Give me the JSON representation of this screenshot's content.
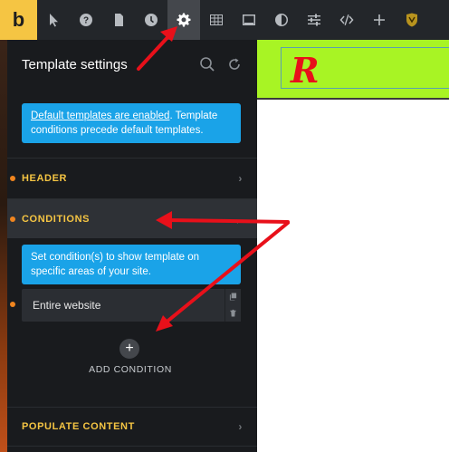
{
  "toolbar": {
    "logo": "b",
    "icons": [
      "cursor-icon",
      "help-icon",
      "page-icon",
      "history-icon",
      "gear-icon",
      "grid-icon",
      "template-icon",
      "contrast-icon",
      "sliders-icon",
      "code-icon",
      "plus-icon",
      "shield-icon"
    ],
    "active": "gear-icon"
  },
  "panel": {
    "title": "Template settings",
    "notice_link": "Default templates are enabled",
    "notice_text": ". Template conditions precede default templates.",
    "sections": {
      "header": "HEADER",
      "conditions": "CONDITIONS",
      "populate": "POPULATE CONTENT"
    },
    "conditions_hint": "Set condition(s) to show template on specific areas of your site.",
    "condition_value": "Entire website",
    "add_condition": "ADD CONDITION"
  },
  "canvas": {
    "logo_letter": "R"
  },
  "colors": {
    "accent_yellow": "#f5c543",
    "info_blue": "#1aa3e8",
    "banner_green": "#a8f424",
    "arrow_red": "#e8101a",
    "dot_orange": "#f0851f"
  }
}
